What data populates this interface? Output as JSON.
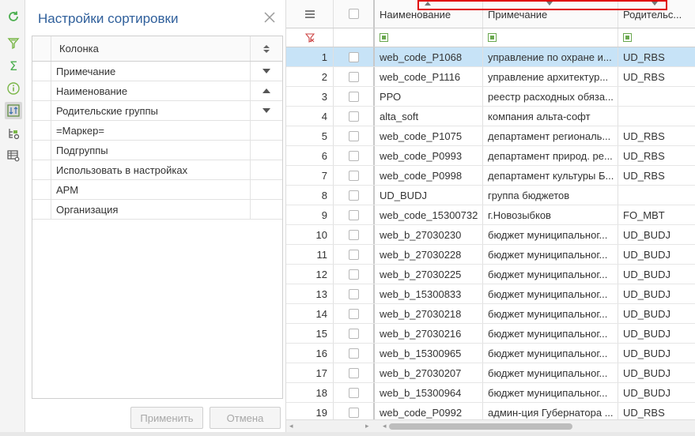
{
  "sort_panel": {
    "title": "Настройки сортировки",
    "column_header": "Колонка",
    "rows": [
      {
        "label": "Примечание",
        "direction": "desc"
      },
      {
        "label": "Наименование",
        "direction": "asc"
      },
      {
        "label": "Родительские группы",
        "direction": "desc"
      },
      {
        "label": "=Маркер=",
        "direction": "none"
      },
      {
        "label": "Подгруппы",
        "direction": "none"
      },
      {
        "label": "Использовать в настройках",
        "direction": "none"
      },
      {
        "label": "АРМ",
        "direction": "none"
      },
      {
        "label": "Организация",
        "direction": "none"
      }
    ],
    "apply_label": "Применить",
    "cancel_label": "Отмена"
  },
  "grid": {
    "headers": {
      "name": "Наименование",
      "note": "Примечание",
      "parent": "Родительс..."
    },
    "rows": [
      {
        "num": "1",
        "name": "web_code_P1068",
        "note": "управление по охране и...",
        "parent": "UD_RBS"
      },
      {
        "num": "2",
        "name": "web_code_P1116",
        "note": "управление архитектур...",
        "parent": "UD_RBS"
      },
      {
        "num": "3",
        "name": "РРО",
        "note": "реестр расходных обяза...",
        "parent": ""
      },
      {
        "num": "4",
        "name": "alta_soft",
        "note": "компания альта-софт",
        "parent": ""
      },
      {
        "num": "5",
        "name": "web_code_P1075",
        "note": "департамент региональ...",
        "parent": "UD_RBS"
      },
      {
        "num": "6",
        "name": "web_code_P0993",
        "note": "департамент природ. ре...",
        "parent": "UD_RBS"
      },
      {
        "num": "7",
        "name": "web_code_P0998",
        "note": "департамент культуры Б...",
        "parent": "UD_RBS"
      },
      {
        "num": "8",
        "name": "UD_BUDJ",
        "note": "группа бюджетов",
        "parent": ""
      },
      {
        "num": "9",
        "name": "web_code_15300732",
        "note": "г.Новозыбков",
        "parent": "FO_MBT"
      },
      {
        "num": "10",
        "name": "web_b_27030230",
        "note": "бюджет муниципальног...",
        "parent": "UD_BUDJ"
      },
      {
        "num": "11",
        "name": "web_b_27030228",
        "note": "бюджет муниципальног...",
        "parent": "UD_BUDJ"
      },
      {
        "num": "12",
        "name": "web_b_27030225",
        "note": "бюджет муниципальног...",
        "parent": "UD_BUDJ"
      },
      {
        "num": "13",
        "name": "web_b_15300833",
        "note": "бюджет муниципальног...",
        "parent": "UD_BUDJ"
      },
      {
        "num": "14",
        "name": "web_b_27030218",
        "note": "бюджет муниципальног...",
        "parent": "UD_BUDJ"
      },
      {
        "num": "15",
        "name": "web_b_27030216",
        "note": "бюджет муниципальног...",
        "parent": "UD_BUDJ"
      },
      {
        "num": "16",
        "name": "web_b_15300965",
        "note": "бюджет муниципальног...",
        "parent": "UD_BUDJ"
      },
      {
        "num": "17",
        "name": "web_b_27030207",
        "note": "бюджет муниципальног...",
        "parent": "UD_BUDJ"
      },
      {
        "num": "18",
        "name": "web_b_15300964",
        "note": "бюджет муниципальног...",
        "parent": "UD_BUDJ"
      },
      {
        "num": "19",
        "name": "web_code_P0992",
        "note": "админ-ция Губернатора ...",
        "parent": "UD_RBS"
      }
    ],
    "selected_row": "1"
  },
  "colors": {
    "accent": "#2f5f9b",
    "selection": "#c7e3f7",
    "highlight_box": "#e00000"
  },
  "toolbar_icons": [
    "refresh-icon",
    "filter-icon",
    "sum-icon",
    "info-icon",
    "sort-icon",
    "tree-settings-icon",
    "grid-settings-icon"
  ]
}
